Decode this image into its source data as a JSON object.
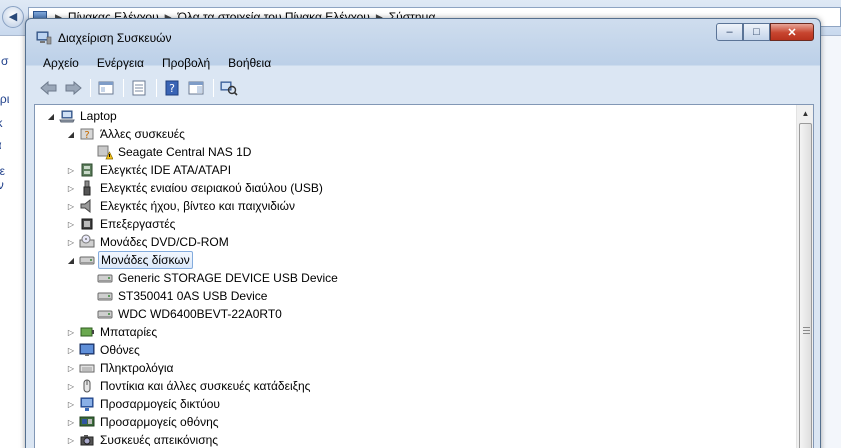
{
  "background_window": {
    "breadcrumbs": [
      "Πίνακας Ελέγχου",
      "Όλα τα στοιχεία του Πίνακα Ελέγχου",
      "Σύστημα"
    ],
    "sidebar_fragments": [
      "χική σ",
      "ιαχείρι",
      "ομακ",
      "οστα",
      "θμίσε",
      "οχων"
    ]
  },
  "window": {
    "title": "Διαχείριση Συσκευών",
    "buttons": {
      "minimize": "–",
      "maximize": "□",
      "close": "✕"
    }
  },
  "menu": [
    "Αρχείο",
    "Ενέργεια",
    "Προβολή",
    "Βοήθεια"
  ],
  "toolbar": [
    {
      "name": "back",
      "icon": "arrow-left-icon"
    },
    {
      "name": "forward",
      "icon": "arrow-right-icon"
    },
    {
      "name": "show-hide-console-tree",
      "icon": "console-tree-icon"
    },
    {
      "name": "properties",
      "icon": "properties-icon"
    },
    {
      "name": "help",
      "icon": "help-icon"
    },
    {
      "name": "show-action-pane",
      "icon": "action-pane-icon"
    },
    {
      "name": "scan-hardware",
      "icon": "scan-hardware-icon"
    }
  ],
  "tree": {
    "root": "Laptop",
    "items": [
      {
        "label": "Άλλες συσκευές",
        "level": 1,
        "expanded": true,
        "icon": "unknown-device-icon"
      },
      {
        "label": "Seagate Central NAS 1D",
        "level": 2,
        "icon": "warning-device-icon"
      },
      {
        "label": "Ελεγκτές IDE ATA/ATAPI",
        "level": 1,
        "expanded": false,
        "icon": "ide-controller-icon"
      },
      {
        "label": "Ελεγκτές ενιαίου σειριακού διαύλου (USB)",
        "level": 1,
        "expanded": false,
        "icon": "usb-icon"
      },
      {
        "label": "Ελεγκτές ήχου, βίντεο και παιχνιδιών",
        "level": 1,
        "expanded": false,
        "icon": "speaker-icon"
      },
      {
        "label": "Επεξεργαστές",
        "level": 1,
        "expanded": false,
        "icon": "processor-icon"
      },
      {
        "label": "Μονάδες DVD/CD-ROM",
        "level": 1,
        "expanded": false,
        "icon": "dvd-drive-icon"
      },
      {
        "label": "Μονάδες δίσκων",
        "level": 1,
        "expanded": true,
        "selected": true,
        "icon": "disk-drive-icon"
      },
      {
        "label": "Generic STORAGE DEVICE USB Device",
        "level": 2,
        "icon": "disk-drive-icon"
      },
      {
        "label": "ST350041 0AS USB Device",
        "level": 2,
        "icon": "disk-drive-icon"
      },
      {
        "label": "WDC WD6400BEVT-22A0RT0",
        "level": 2,
        "icon": "disk-drive-icon"
      },
      {
        "label": "Μπαταρίες",
        "level": 1,
        "expanded": false,
        "icon": "battery-icon"
      },
      {
        "label": "Οθόνες",
        "level": 1,
        "expanded": false,
        "icon": "monitor-icon"
      },
      {
        "label": "Πληκτρολόγια",
        "level": 1,
        "expanded": false,
        "icon": "keyboard-icon"
      },
      {
        "label": "Ποντίκια και άλλες συσκευές κατάδειξης",
        "level": 1,
        "expanded": false,
        "icon": "mouse-icon"
      },
      {
        "label": "Προσαρμογείς δικτύου",
        "level": 1,
        "expanded": false,
        "icon": "network-adapter-icon"
      },
      {
        "label": "Προσαρμογείς οθόνης",
        "level": 1,
        "expanded": false,
        "icon": "display-adapter-icon"
      },
      {
        "label": "Συσκευές απεικόνισης",
        "level": 1,
        "expanded": false,
        "icon": "camera-icon"
      }
    ]
  },
  "colors": {
    "selection_border": "#84acdd",
    "selection_fill": "#dbe8f9",
    "title_bar": "#bcd0e8",
    "close_button": "#c7452f"
  }
}
